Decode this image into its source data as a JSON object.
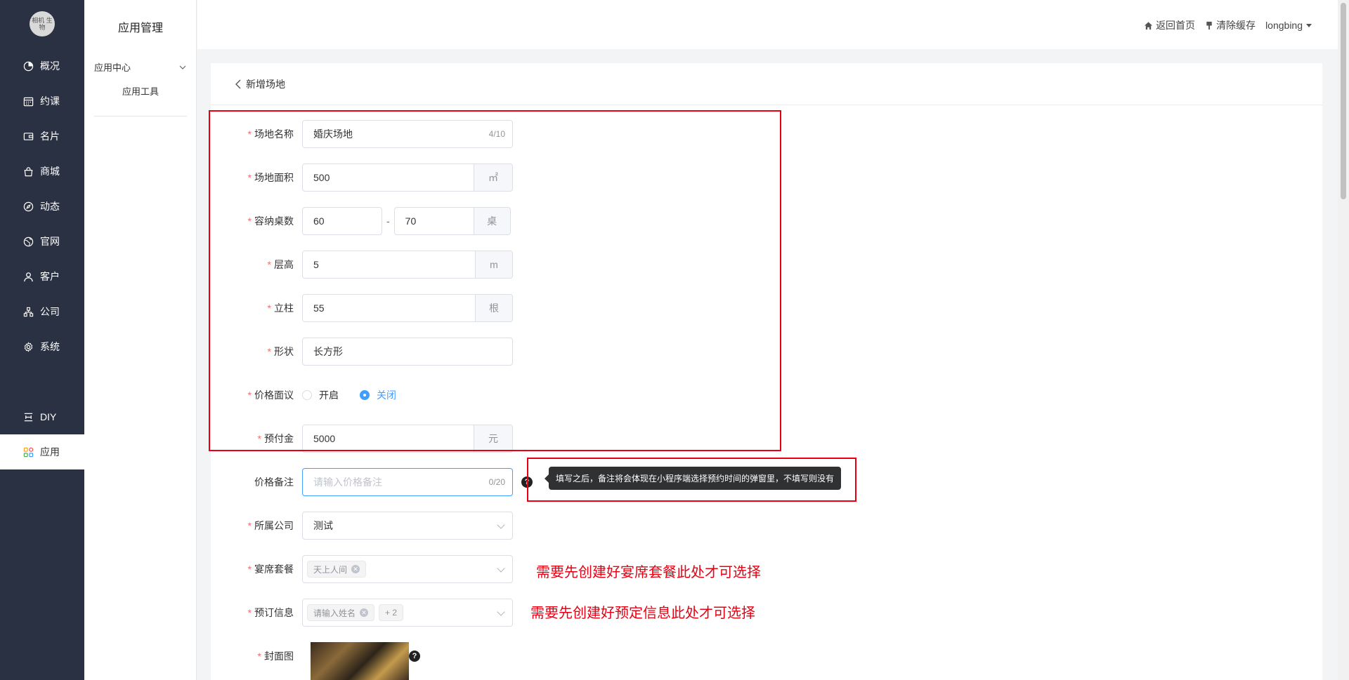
{
  "sidebar": {
    "logo_text": "相机 生物",
    "items": [
      {
        "label": "概况",
        "icon": "pie-chart-icon"
      },
      {
        "label": "约课",
        "icon": "calendar-icon"
      },
      {
        "label": "名片",
        "icon": "card-icon"
      },
      {
        "label": "商城",
        "icon": "shopping-bag-icon"
      },
      {
        "label": "动态",
        "icon": "compass-icon"
      },
      {
        "label": "官网",
        "icon": "globe-icon"
      },
      {
        "label": "客户",
        "icon": "user-icon"
      },
      {
        "label": "公司",
        "icon": "org-icon"
      },
      {
        "label": "系统",
        "icon": "gear-icon"
      }
    ],
    "diy_label": "DIY",
    "app_label": "应用"
  },
  "submenu": {
    "title": "应用管理",
    "group_label": "应用中心",
    "item_label": "应用工具"
  },
  "topbar": {
    "home_label": "返回首页",
    "clear_cache_label": "清除缓存",
    "user_label": "longbing"
  },
  "page": {
    "title": "新增场地"
  },
  "form": {
    "venue_name": {
      "label": "场地名称",
      "value": "婚庆场地",
      "count": "4/10"
    },
    "area": {
      "label": "场地面积",
      "value": "500",
      "unit": "㎡"
    },
    "tables": {
      "label": "容纳桌数",
      "min": "60",
      "max": "70",
      "separator": "-",
      "unit": "桌"
    },
    "floor_height": {
      "label": "层高",
      "value": "5",
      "unit": "m"
    },
    "pillars": {
      "label": "立柱",
      "value": "55",
      "unit": "根"
    },
    "shape": {
      "label": "形状",
      "value": "长方形"
    },
    "price_negotiable": {
      "label": "价格面议",
      "option_on": "开启",
      "option_off": "关闭",
      "selected": "关闭"
    },
    "deposit": {
      "label": "预付金",
      "value": "5000",
      "unit": "元"
    },
    "price_note": {
      "label": "价格备注",
      "placeholder": "请输入价格备注",
      "count": "0/20",
      "tooltip": "填写之后，备注将会体现在小程序端选择预约时间的弹窗里，不填写则没有"
    },
    "company": {
      "label": "所属公司",
      "value": "测试"
    },
    "banquet": {
      "label": "宴席套餐",
      "tags": [
        "天上人间"
      ],
      "note": "需要先创建好宴席套餐此处才可选择"
    },
    "booking_info": {
      "label": "预订信息",
      "tags": [
        "请输入姓名"
      ],
      "more": "+ 2",
      "note": "需要先创建好预定信息此处才可选择"
    },
    "cover": {
      "label": "封面图"
    }
  },
  "colors": {
    "sidebar_bg": "#2a3142",
    "primary": "#409eff",
    "required": "#f56c6c",
    "annotation_red": "#e60012"
  }
}
